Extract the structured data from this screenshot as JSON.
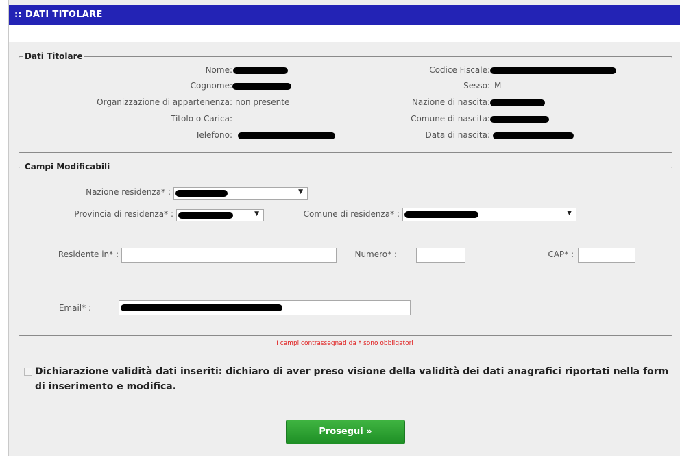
{
  "header": {
    "title": ":: DATI TITOLARE"
  },
  "titolare": {
    "legend": "Dati Titolare",
    "nome_label": "Nome:",
    "cognome_label": "Cognome:",
    "organizzazione_label": "Organizzazione di appartenenza:",
    "organizzazione_value": "non presente",
    "titolo_label": "Titolo o Carica:",
    "telefono_label": "Telefono:",
    "codice_fiscale_label": "Codice Fiscale:",
    "sesso_label": "Sesso:",
    "sesso_value": "M",
    "nazione_nascita_label": "Nazione di nascita:",
    "comune_nascita_label": "Comune di nascita:",
    "data_nascita_label": "Data di nascita:"
  },
  "modificabili": {
    "legend": "Campi Modificabili",
    "nazione_residenza_label": "Nazione residenza* :",
    "provincia_residenza_label": "Provincia di residenza* :",
    "comune_residenza_label": "Comune di residenza* :",
    "residente_label": "Residente in* :",
    "numero_label": "Numero* :",
    "cap_label": "CAP* :",
    "email_label": "Email* :"
  },
  "form": {
    "required_note": "I campi contrassegnati da * sono obbligatori",
    "declaration": "Dichiarazione validità dati inseriti: dichiaro di aver preso visione della validità dei dati anagrafici riportati nella form di inserimento e modifica.",
    "submit_label": "Prosegui »"
  }
}
